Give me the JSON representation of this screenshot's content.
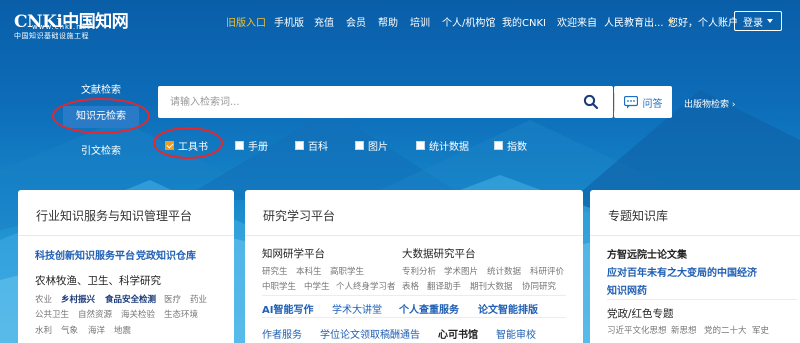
{
  "brand": {
    "logo_main": "CNKi中国知网",
    "logo_url": "www.cnki.net",
    "logo_sub": "中国知识基础设施工程"
  },
  "nav": {
    "items": [
      "旧版入口",
      "手机版",
      "充值",
      "会员",
      "帮助",
      "培训",
      "个人/机构馆",
      "我的CNKI",
      "欢迎来自",
      "人民教育出..."
    ],
    "greeting": "您好，个人账户",
    "login": "登录"
  },
  "search": {
    "tabs": [
      "文献检索",
      "知识元检索",
      "引文检索"
    ],
    "active_tab": "知识元检索",
    "placeholder": "请输入检索词...",
    "qa_label": "问答",
    "pub_search": "出版物检索 ›",
    "checkboxes": [
      {
        "label": "工具书",
        "checked": true
      },
      {
        "label": "手册",
        "checked": false
      },
      {
        "label": "百科",
        "checked": false
      },
      {
        "label": "图片",
        "checked": false
      },
      {
        "label": "统计数据",
        "checked": false
      },
      {
        "label": "指数",
        "checked": false
      }
    ]
  },
  "cards": {
    "industry": {
      "title": "行业知识服务与知识管理平台",
      "links": [
        "科技创新知识服务平台",
        "党政知识仓库"
      ],
      "section": "农林牧渔、卫生、科学研究",
      "row1": [
        "农业",
        "乡村振兴",
        "食品安全检测",
        "医疗",
        "药业"
      ],
      "row2": [
        "公共卫生",
        "自然资源",
        "海关检验",
        "生态环境"
      ],
      "row3": [
        "水利",
        "气象",
        "海洋",
        "地震"
      ]
    },
    "research": {
      "title": "研究学习平台",
      "col1_title": "知网研学平台",
      "col1_items": [
        "研究生",
        "本科生",
        "高职学生",
        "中职学生",
        "中学生",
        "个人终身学习者"
      ],
      "col2_title": "大数据研究平台",
      "col2_items": [
        "专利分析",
        "学术图片",
        "统计数据",
        "科研评价",
        "表格",
        "翻译助手",
        "期刊大数据",
        "协同研究"
      ],
      "services": [
        "AI智能写作",
        "学术大讲堂",
        "个人查重服务",
        "论文智能排版"
      ],
      "services2": [
        "作者服务",
        "学位论文领取稿酬通告",
        "心可书馆",
        "智能审校"
      ]
    },
    "topics": {
      "title": "专题知识库",
      "item1": "方智远院士论文集",
      "item2": "应对百年未有之大变局的中国经济",
      "item3": "知识网药",
      "section": "党政/红色专题",
      "row": [
        "习近平文化思想",
        "新思想",
        "党的二十大",
        "军史"
      ]
    }
  },
  "colors": {
    "accent": "#f5c12d",
    "highlight_oval": "#e8262b",
    "link_blue": "#1f5fb4",
    "checked": "#f29c1f"
  }
}
